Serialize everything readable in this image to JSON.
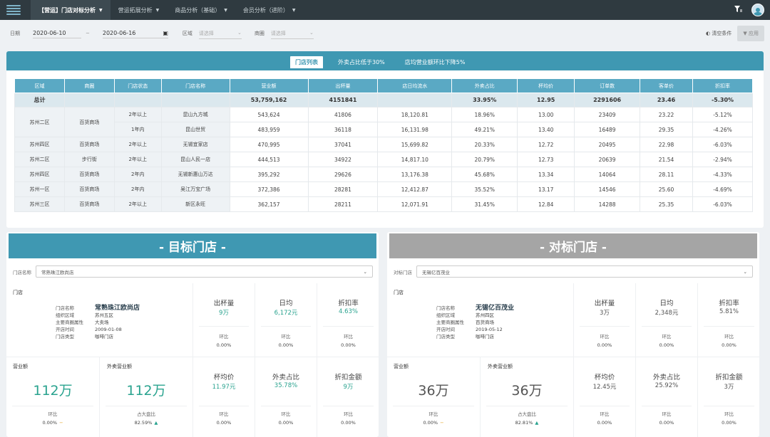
{
  "topbar": {
    "nav": [
      {
        "label": "【营运】门店对标分析",
        "active": true
      },
      {
        "label": "营运拓展分析",
        "active": false
      },
      {
        "label": "商品分析（基础）",
        "active": false
      },
      {
        "label": "会员分析（进阶）",
        "active": false
      }
    ]
  },
  "filters": {
    "date_label": "日期",
    "date_start": "2020-06-10",
    "date_sep": "~",
    "date_end": "2020-06-16",
    "region_label": "区域",
    "region_placeholder": "请选择",
    "circle_label": "商圈",
    "circle_placeholder": "请选择",
    "clear_label": "清空条件",
    "apply_label": "应用"
  },
  "tabs": [
    "门店列表",
    "外卖占比低于30%",
    "店均营业额环比下降5%"
  ],
  "table": {
    "headers": [
      "区域",
      "商圈",
      "门店状态",
      "门店名称",
      "营业额",
      "出杯量",
      "店日均流水",
      "外卖占比",
      "杯均价",
      "订单数",
      "客单价",
      "折扣率"
    ],
    "total": {
      "label": "总计",
      "revenue": "53,759,162",
      "cups": "4151841",
      "daily": "",
      "takeout": "33.95%",
      "cup_price": "12.95",
      "orders": "2291606",
      "per_order": "23.46",
      "discount": "-5.30%"
    },
    "rows": [
      {
        "region": "苏州二区",
        "circle": "百货商场",
        "status": "2年以上",
        "name": "昆山九方城",
        "revenue": "543,624",
        "cups": "41806",
        "daily": "18,120.81",
        "takeout": "18.96%",
        "cup_price": "13.00",
        "orders": "23409",
        "per_order": "23.22",
        "discount": "-5.12%"
      },
      {
        "region": "",
        "circle": "",
        "status": "1年内",
        "name": "昆山世贸",
        "revenue": "483,959",
        "cups": "36118",
        "daily": "16,131.98",
        "takeout": "49.21%",
        "cup_price": "13.40",
        "orders": "16489",
        "per_order": "29.35",
        "discount": "-4.26%"
      },
      {
        "region": "苏州四区",
        "circle": "百货商场",
        "status": "2年以上",
        "name": "无锡宜家店",
        "revenue": "470,995",
        "cups": "37041",
        "daily": "15,699.82",
        "takeout": "20.33%",
        "cup_price": "12.72",
        "orders": "20495",
        "per_order": "22.98",
        "discount": "-6.03%"
      },
      {
        "region": "苏州二区",
        "circle": "步行街",
        "status": "2年以上",
        "name": "昆山人民一店",
        "revenue": "444,513",
        "cups": "34922",
        "daily": "14,817.10",
        "takeout": "20.79%",
        "cup_price": "12.73",
        "orders": "20639",
        "per_order": "21.54",
        "discount": "-2.94%"
      },
      {
        "region": "苏州四区",
        "circle": "百货商场",
        "status": "2年内",
        "name": "无锡新惠山万达",
        "revenue": "395,292",
        "cups": "29626",
        "daily": "13,176.38",
        "takeout": "45.68%",
        "cup_price": "13.34",
        "orders": "14064",
        "per_order": "28.11",
        "discount": "-4.33%"
      },
      {
        "region": "苏州一区",
        "circle": "百货商场",
        "status": "2年内",
        "name": "吴江万宝广场",
        "revenue": "372,386",
        "cups": "28281",
        "daily": "12,412.87",
        "takeout": "35.52%",
        "cup_price": "13.17",
        "orders": "14546",
        "per_order": "25.60",
        "discount": "-4.69%"
      },
      {
        "region": "苏州三区",
        "circle": "百货商场",
        "status": "2年以上",
        "name": "新区永旺",
        "revenue": "362,157",
        "cups": "28211",
        "daily": "12,071.91",
        "takeout": "31.45%",
        "cup_price": "12.84",
        "orders": "14288",
        "per_order": "25.35",
        "discount": "-6.03%"
      }
    ]
  },
  "left": {
    "title": "- 目标门店 -",
    "select_label": "门店名称",
    "select_value": "常熟珠江欧尚店",
    "store_header": "门店",
    "store": [
      {
        "k": "门店名称",
        "v": "常熟珠江欧尚店"
      },
      {
        "k": "组织区域",
        "v": "苏州五区"
      },
      {
        "k": "主要商圈属性",
        "v": "大卖场"
      },
      {
        "k": "开店时间",
        "v": "2009-01-08"
      },
      {
        "k": "门店类型",
        "v": "咖啡门店"
      }
    ],
    "metrics": [
      {
        "t": "出杯量",
        "v": "9万",
        "cl": "环比",
        "cv": "0.00%"
      },
      {
        "t": "日均",
        "v": "6,172元",
        "cl": "环比",
        "cv": "0.00%"
      },
      {
        "t": "折扣率",
        "v": "4.63%",
        "cl": "环比",
        "cv": "0.00%"
      },
      {
        "t": "杯均价",
        "v": "11.97元",
        "cl": "环比",
        "cv": "0.00%"
      },
      {
        "t": "外卖占比",
        "v": "35.78%",
        "cl": "环比",
        "cv": "0.00%"
      },
      {
        "t": "折扣金额",
        "v": "9万",
        "cl": "环比",
        "cv": "0.00%"
      }
    ],
    "revenue": {
      "h": "营业额",
      "v": "112万",
      "cl": "环比",
      "cv": "0.00%",
      "mark": "−"
    },
    "takeout_rev": {
      "h": "外卖营业额",
      "v": "112万",
      "cl": "占大盘比",
      "cv": "82.59%",
      "mark": "▲"
    }
  },
  "right": {
    "title": "- 对标门店 -",
    "select_label": "对标门店",
    "select_value": "无锡亿百茂业",
    "store_header": "门店",
    "store": [
      {
        "k": "门店名称",
        "v": "无锡亿百茂业"
      },
      {
        "k": "组织区域",
        "v": "苏州四区"
      },
      {
        "k": "主要商圈属性",
        "v": "百货商场"
      },
      {
        "k": "开店时间",
        "v": "2019-05-12"
      },
      {
        "k": "门店类型",
        "v": "咖啡门店"
      }
    ],
    "metrics": [
      {
        "t": "出杯量",
        "v": "3万",
        "cl": "环比",
        "cv": "0.00%"
      },
      {
        "t": "日均",
        "v": "2,348元",
        "cl": "环比",
        "cv": "0.00%"
      },
      {
        "t": "折扣率",
        "v": "5.81%",
        "cl": "环比",
        "cv": "0.00%"
      },
      {
        "t": "杯均价",
        "v": "12.45元",
        "cl": "环比",
        "cv": "0.00%"
      },
      {
        "t": "外卖占比",
        "v": "25.92%",
        "cl": "环比",
        "cv": "0.00%"
      },
      {
        "t": "折扣金额",
        "v": "3万",
        "cl": "环比",
        "cv": "0.00%"
      }
    ],
    "revenue": {
      "h": "营业额",
      "v": "36万",
      "cl": "环比",
      "cv": "0.00%",
      "mark": "−"
    },
    "takeout_rev": {
      "h": "外卖营业额",
      "v": "36万",
      "cl": "占大盘比",
      "cv": "82.81%",
      "mark": "▲"
    }
  }
}
